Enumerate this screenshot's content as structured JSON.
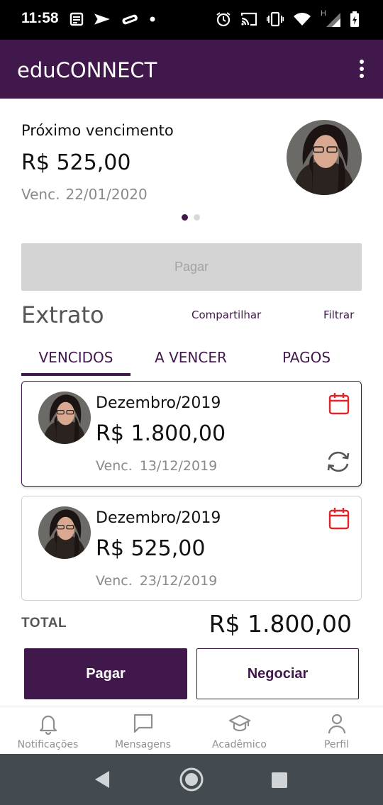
{
  "status_bar": {
    "time": "11:58",
    "left_icons": [
      "news-icon",
      "send-icon",
      "game-icon",
      "dot-icon"
    ],
    "right_icons": [
      "alarm-icon",
      "cast-icon",
      "vibrate-icon",
      "wifi-icon",
      "signal-icon",
      "battery-icon"
    ],
    "signal_label": "H"
  },
  "app_bar": {
    "title": "eduCONNECT",
    "menu_icon": "more-vert-icon"
  },
  "next_payment": {
    "label": "Próximo vencimento",
    "amount": "R$ 525,00",
    "due_label": "Venc.",
    "due_date": "22/01/2020",
    "pager": {
      "total": 2,
      "active": 0
    }
  },
  "pay_button_disabled": "Pagar",
  "statement": {
    "title": "Extrato",
    "share_label": "Compartilhar",
    "filter_label": "Filtrar",
    "tabs": [
      {
        "label": "VENCIDOS",
        "active": true
      },
      {
        "label": "A VENCER",
        "active": false
      },
      {
        "label": "PAGOS",
        "active": false
      }
    ],
    "items": [
      {
        "month": "Dezembro/2019",
        "amount": "R$ 1.800,00",
        "due_label": "Venc.",
        "due_date": "13/12/2019",
        "selected": true,
        "has_sync": true
      },
      {
        "month": "Dezembro/2019",
        "amount": "R$ 525,00",
        "due_label": "Venc.",
        "due_date": "23/12/2019",
        "selected": false,
        "has_sync": false
      }
    ]
  },
  "total": {
    "label": "TOTAL",
    "value": "R$ 1.800,00"
  },
  "actions": {
    "pay": "Pagar",
    "negotiate": "Negociar"
  },
  "bottom_nav": [
    {
      "label": "Notificações",
      "icon": "bell-icon"
    },
    {
      "label": "Mensagens",
      "icon": "message-icon"
    },
    {
      "label": "Acadêmico",
      "icon": "graduation-cap-icon"
    },
    {
      "label": "Perfil",
      "icon": "person-icon"
    }
  ],
  "colors": {
    "primary": "#41184b",
    "accent_red": "#e0242a",
    "muted_text": "#8a8a8a",
    "disabled_bg": "#d4d4d4",
    "system_nav": "#434b50"
  }
}
